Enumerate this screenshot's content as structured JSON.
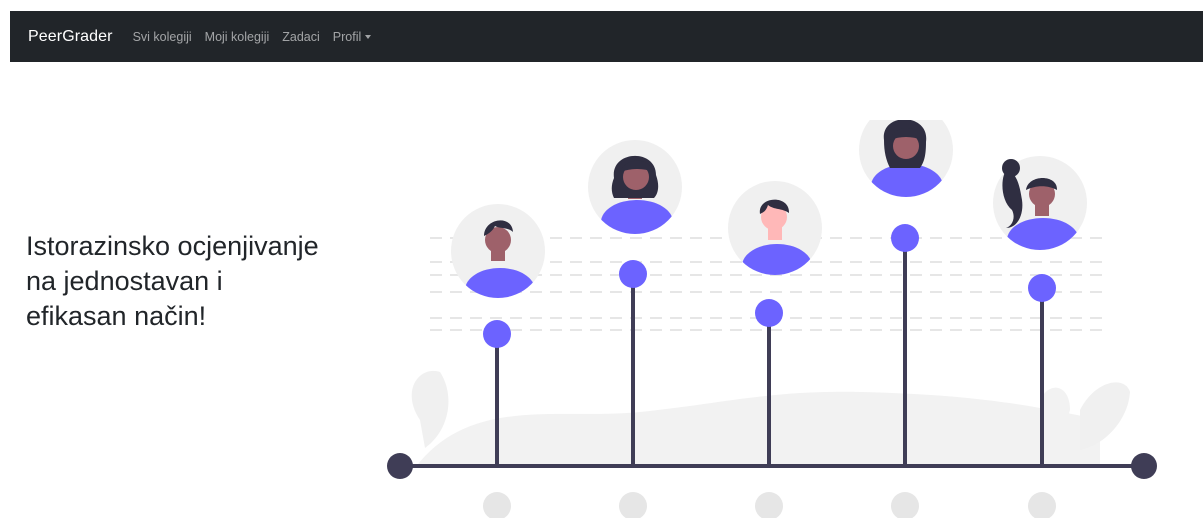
{
  "navbar": {
    "brand": "PeerGrader",
    "links": [
      "Svi kolegiji",
      "Moji kolegiji",
      "Zadaci"
    ],
    "dropdown_label": "Profil"
  },
  "hero": {
    "title": "Istorazinsko ocjenjivanje na jednostavan i efikasan način!"
  },
  "colors": {
    "navbar_bg": "#212529",
    "accent_purple": "#6c63ff",
    "dark_line": "#3f3d56",
    "light_gray": "#f0f0f0"
  },
  "icons": [
    "caret-down-icon",
    "person-avatar"
  ]
}
